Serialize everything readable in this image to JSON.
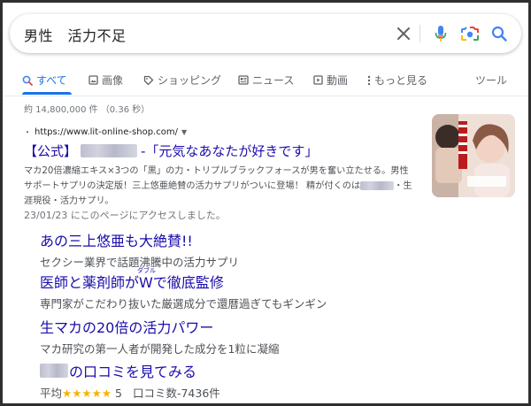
{
  "search": {
    "query": "男性　活力不足"
  },
  "tabs": [
    {
      "label": "すべて",
      "icon": "search-icon",
      "active": true
    },
    {
      "label": "画像",
      "icon": "image-icon"
    },
    {
      "label": "ショッピング",
      "icon": "tag-icon"
    },
    {
      "label": "ニュース",
      "icon": "news-icon"
    },
    {
      "label": "動画",
      "icon": "video-icon"
    },
    {
      "label": "もっと見る",
      "icon": "more-vert-icon"
    }
  ],
  "tools_label": "ツール",
  "result_stats": "約 14,800,000 件 （0.36 秒）",
  "result": {
    "url": "https://www.lit-online-shop.com/",
    "title_prefix": "【公式】",
    "title_suffix": "-「元気なあなたが好きです」",
    "snippet_line1": "マカ20倍濃縮エキス×3つの「黒」の力・トリプルブラックフォースが男を奮い立たせる。男性",
    "snippet_line2_a": "サポートサプリの決定版！三上悠亜絶賛の活力サプリがついに登場！ 精が付くのは",
    "snippet_line2_b": "・生",
    "snippet_line3": "涯現役・活力サプリ。",
    "visited": "23/01/23 にこのページにアクセスしました。"
  },
  "sitelinks": {
    "one": {
      "title": "あの三上悠亜も大絶賛!!",
      "desc": "セクシー業界で話題沸騰中の活力サプリ"
    },
    "two": {
      "title_a": "医師と薬剤師が",
      "title_w": "W",
      "title_ruby": "ダブル",
      "title_b": "で徹底監修",
      "desc": "専門家がこだわり抜いた厳選成分で還暦過ぎてもギンギン"
    },
    "three": {
      "title": "生マカの20倍の活力パワー",
      "desc": "マカ研究の第一人者が開発した成分を1粒に凝縮"
    },
    "four": {
      "title": "の口コミを見てみる",
      "rating_prefix": "平均",
      "stars": "★★★★★",
      "rating_value": "5",
      "review_count": "口コミ数-7436件"
    }
  },
  "colors": {
    "link": "#1a0dab",
    "accent": "#1a73e8",
    "star": "#f6b400"
  }
}
